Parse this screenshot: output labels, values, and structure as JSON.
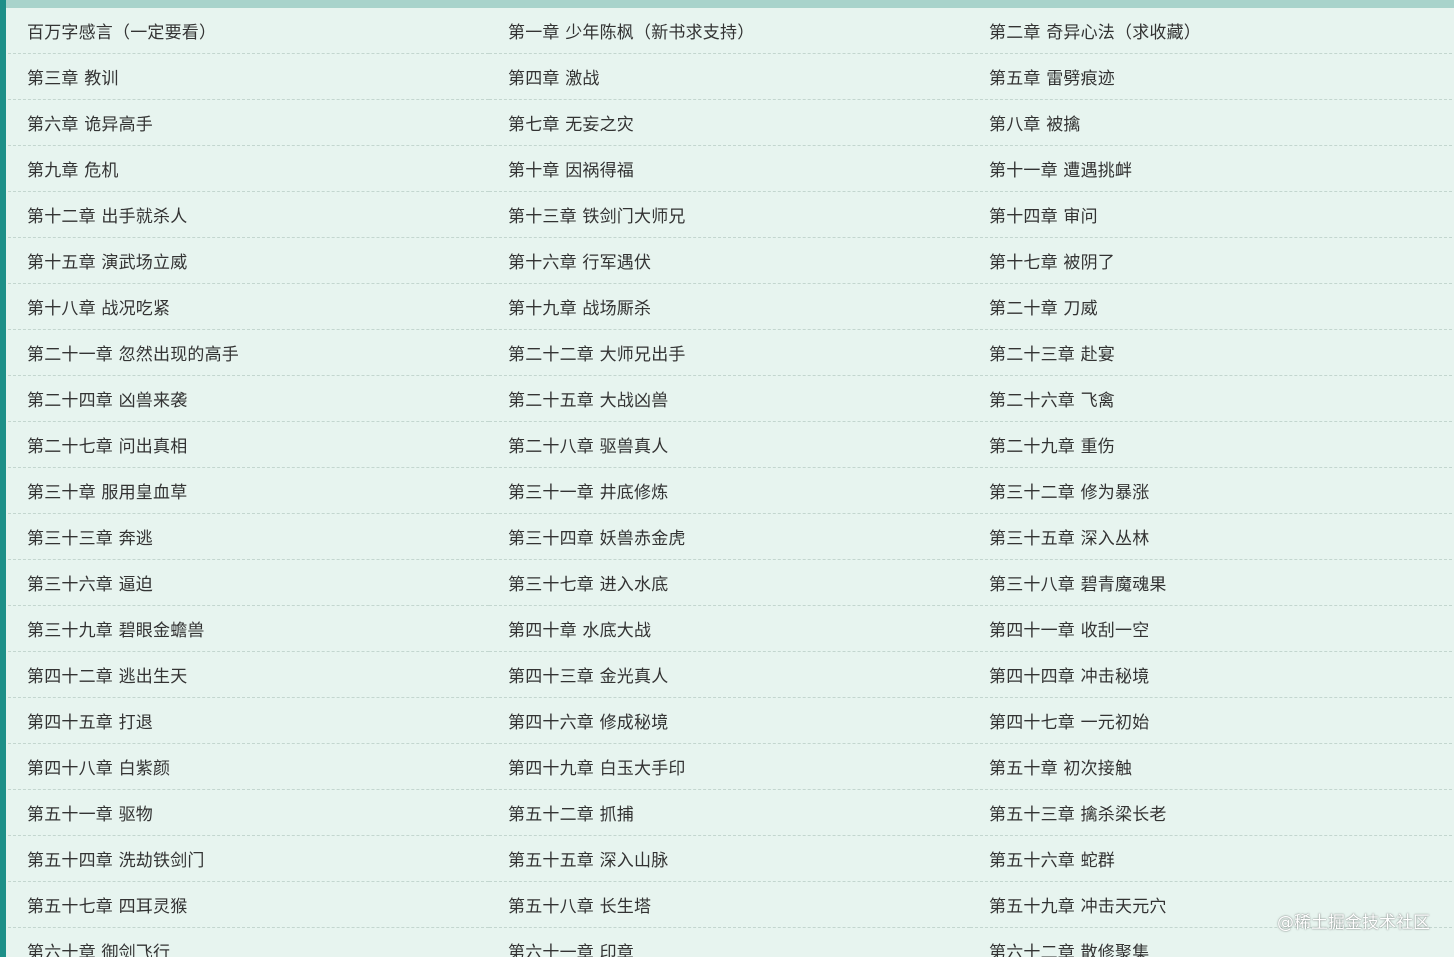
{
  "chapters": [
    "百万字感言（一定要看）",
    "第一章 少年陈枫（新书求支持）",
    "第二章 奇异心法（求收藏）",
    "第三章 教训",
    "第四章 激战",
    "第五章 雷劈痕迹",
    "第六章 诡异高手",
    "第七章 无妄之灾",
    "第八章 被擒",
    "第九章 危机",
    "第十章 因祸得福",
    "第十一章 遭遇挑衅",
    "第十二章 出手就杀人",
    "第十三章 铁剑门大师兄",
    "第十四章 审问",
    "第十五章 演武场立威",
    "第十六章 行军遇伏",
    "第十七章 被阴了",
    "第十八章 战况吃紧",
    "第十九章 战场厮杀",
    "第二十章 刀威",
    "第二十一章 忽然出现的高手",
    "第二十二章 大师兄出手",
    "第二十三章 赴宴",
    "第二十四章 凶兽来袭",
    "第二十五章 大战凶兽",
    "第二十六章 飞禽",
    "第二十七章 问出真相",
    "第二十八章 驱兽真人",
    "第二十九章 重伤",
    "第三十章 服用皇血草",
    "第三十一章 井底修炼",
    "第三十二章 修为暴涨",
    "第三十三章 奔逃",
    "第三十四章 妖兽赤金虎",
    "第三十五章 深入丛林",
    "第三十六章 逼迫",
    "第三十七章 进入水底",
    "第三十八章 碧青魔魂果",
    "第三十九章 碧眼金蟾兽",
    "第四十章 水底大战",
    "第四十一章 收刮一空",
    "第四十二章 逃出生天",
    "第四十三章 金光真人",
    "第四十四章 冲击秘境",
    "第四十五章 打退",
    "第四十六章 修成秘境",
    "第四十七章 一元初始",
    "第四十八章 白紫颜",
    "第四十九章 白玉大手印",
    "第五十章 初次接触",
    "第五十一章 驱物",
    "第五十二章 抓捕",
    "第五十三章 擒杀梁长老",
    "第五十四章 洗劫铁剑门",
    "第五十五章 深入山脉",
    "第五十六章 蛇群",
    "第五十七章 四耳灵猴",
    "第五十八章 长生塔",
    "第五十九章 冲击天元穴",
    "第六十章 御剑飞行",
    "第六十一章 印章",
    "第六十二章 散修聚集"
  ],
  "watermark": "@稀土掘金技术社区"
}
